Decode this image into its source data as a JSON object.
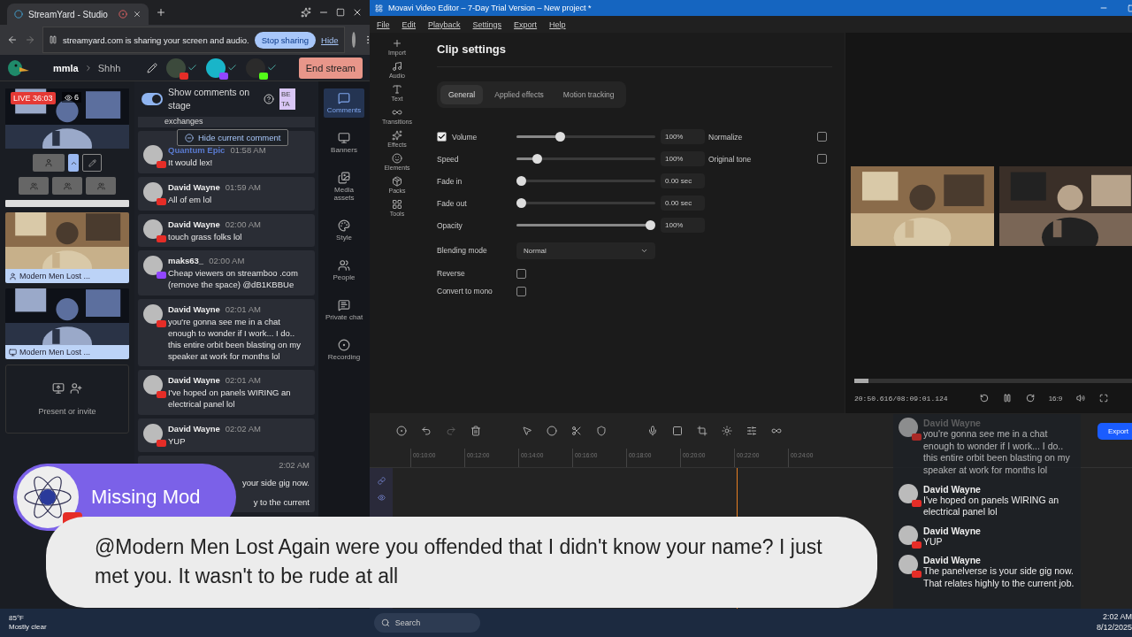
{
  "browser": {
    "tab_title": "StreamYard - Studio",
    "share_notice": {
      "text": "streamyard.com is sharing your screen and audio.",
      "stop_button": "Stop sharing",
      "hide_link": "Hide"
    }
  },
  "studio": {
    "breadcrumb": [
      "mmla",
      "Shhh"
    ],
    "end_button": "End stream",
    "guests": [
      {
        "kind": "youtube"
      },
      {
        "kind": "twitch"
      },
      {
        "kind": "kick"
      }
    ],
    "live": {
      "badge": "LIVE 36:03",
      "viewers": "6"
    },
    "tiles": [
      {
        "kind": "camera",
        "label": "Modern Men Lost ..."
      },
      {
        "kind": "screen",
        "label": "Modern Men Lost ..."
      }
    ],
    "present": "Present or invite",
    "comments_panel": {
      "toggle": {
        "label": "Show comments on stage",
        "on": true
      },
      "badge": "BETA",
      "clipped_top": "exchanges",
      "hide_button": "Hide current comment",
      "comments": [
        {
          "kind": "youtube",
          "author": "Quantum Epic",
          "time": "01:58 AM",
          "text": "It would lex!"
        },
        {
          "kind": "youtube",
          "author": "David Wayne",
          "time": "01:59 AM",
          "text": "All of em lol"
        },
        {
          "kind": "youtube",
          "author": "David Wayne",
          "time": "02:00 AM",
          "text": "touch grass folks lol"
        },
        {
          "kind": "twitch",
          "author": "maks63_",
          "time": "02:00 AM",
          "text": "Cheap viewers on streamboo .com (remove the space) @dB1KBBUe"
        },
        {
          "kind": "youtube",
          "author": "David Wayne",
          "time": "02:01 AM",
          "text": "you're gonna see me in a chat enough to wonder if I work... I do.. this entire orbit been blasting on my speaker at work for months lol"
        },
        {
          "kind": "youtube",
          "author": "David Wayne",
          "time": "02:01 AM",
          "text": "I've hoped on panels WIRING an electrical panel lol"
        },
        {
          "kind": "youtube",
          "author": "David Wayne",
          "time": "02:02 AM",
          "text": "YUP"
        },
        {
          "kind": "clipped",
          "time": "2:02 AM",
          "lines": [
            "your side gig now.",
            "y to the current"
          ]
        }
      ]
    },
    "rail": [
      {
        "label": "Comments",
        "selected": true
      },
      {
        "label": "Banners",
        "selected": false
      },
      {
        "label": "Media assets",
        "selected": false
      },
      {
        "label": "Style",
        "selected": false
      },
      {
        "label": "People",
        "selected": false
      },
      {
        "label": "Private chat",
        "selected": false
      },
      {
        "label": "Recording",
        "selected": false
      }
    ]
  },
  "editor": {
    "title": "Movavi Video Editor – 7-Day Trial Version – New project *",
    "menu": [
      "File",
      "Edit",
      "Playback",
      "Settings",
      "Export",
      "Help"
    ],
    "tools": [
      "Import",
      "Audio",
      "Text",
      "Transitions",
      "Effects",
      "Elements",
      "Packs",
      "Tools"
    ],
    "clip_settings": {
      "heading": "Clip settings",
      "tabs": [
        {
          "label": "General",
          "selected": true
        },
        {
          "label": "Applied effects",
          "selected": false
        },
        {
          "label": "Motion tracking",
          "selected": false
        }
      ],
      "rows": [
        {
          "kind": "check-slider",
          "label": "Volume",
          "checked": true,
          "level": 0.3,
          "value": "100%"
        },
        {
          "kind": "slider",
          "label": "Speed",
          "level": 0.12,
          "value": "100%"
        },
        {
          "kind": "slider",
          "label": "Fade in",
          "level": 0,
          "value": "0.00 sec"
        },
        {
          "kind": "slider",
          "label": "Fade out",
          "level": 0,
          "value": "0.00 sec"
        },
        {
          "kind": "slider",
          "label": "Opacity",
          "level": 1,
          "value": "100%"
        },
        {
          "kind": "dropdown",
          "label": "Blending mode",
          "value": "Normal"
        },
        {
          "kind": "checkbox",
          "label": "Reverse",
          "checked": false
        },
        {
          "kind": "checkbox",
          "label": "Convert to mono",
          "checked": false
        }
      ],
      "options": [
        {
          "label": "Normalize",
          "checked": false
        },
        {
          "label": "Original tone",
          "checked": false
        }
      ]
    },
    "preview": {
      "timecode": "20:50.616/08:09:01.124",
      "aspect": "16:9",
      "progress": {
        "level": 0.05
      }
    },
    "timeline": {
      "export_button": "Export",
      "ruler": [
        "00:10:00",
        "00:12:00",
        "00:14:00",
        "00:16:00",
        "00:18:00",
        "00:20:00",
        "00:22:00",
        "00:24:00"
      ]
    }
  },
  "overlays": {
    "name_banner": "Missing Mod",
    "message": "@Modern Men Lost Again were you offended that I didn't know your name? I just met you. It wasn't to be rude at all",
    "chat": [
      {
        "author": "David Wayne",
        "text": "you're gonna see me in a chat enough to wonder if I work... I do.. this entire orbit been blasting on my speaker at work for months lol",
        "faded": true
      },
      {
        "author": "David Wayne",
        "text": "I've hoped on panels WIRING an electrical panel lol",
        "faded": false
      },
      {
        "author": "David Wayne",
        "text": "YUP",
        "faded": false
      },
      {
        "author": "David Wayne",
        "text": "The panelverse is your side gig now. That relates highly to the current job.",
        "faded": false
      }
    ]
  },
  "taskbar": {
    "temperature": "85°F",
    "condition": "Mostly clear",
    "search": "Search",
    "time": "2:02 AM",
    "date": "8/12/2025"
  }
}
